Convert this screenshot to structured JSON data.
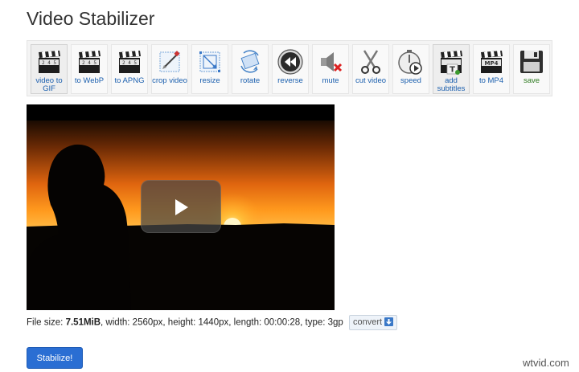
{
  "page": {
    "title": "Video Stabilizer"
  },
  "toolbar": {
    "items": [
      {
        "label": "video to\nGIF",
        "icon": "clapper-gif-icon",
        "active": true
      },
      {
        "label": "to WebP",
        "icon": "clapper-webp-icon"
      },
      {
        "label": "to APNG",
        "icon": "clapper-apng-icon"
      },
      {
        "label": "crop video",
        "icon": "crop-icon"
      },
      {
        "label": "resize",
        "icon": "resize-icon"
      },
      {
        "label": "rotate",
        "icon": "rotate-icon"
      },
      {
        "label": "reverse",
        "icon": "reverse-icon"
      },
      {
        "label": "mute",
        "icon": "mute-icon"
      },
      {
        "label": "cut video",
        "icon": "scissors-icon"
      },
      {
        "label": "speed",
        "icon": "speed-icon"
      },
      {
        "label": "add\nsubtitles",
        "icon": "subtitles-icon",
        "active": true
      },
      {
        "label": "to MP4",
        "icon": "clapper-mp4-icon"
      },
      {
        "label": "save",
        "icon": "save-icon"
      }
    ],
    "clapper_text": "2 4 5",
    "mp4_text": "MP4"
  },
  "video": {
    "play_icon": "play-icon"
  },
  "file_info": {
    "prefix": "File size: ",
    "size": "7.51MiB",
    "details": ", width: 2560px, height: 1440px, length: 00:00:28, type: 3gp",
    "convert_label": "convert"
  },
  "actions": {
    "stabilize_label": "Stabilize!"
  },
  "watermark": "wtvid.com",
  "colors": {
    "link_blue": "#1b5fae",
    "button_blue": "#2a6ed3",
    "save_green": "#2d7a1f"
  }
}
